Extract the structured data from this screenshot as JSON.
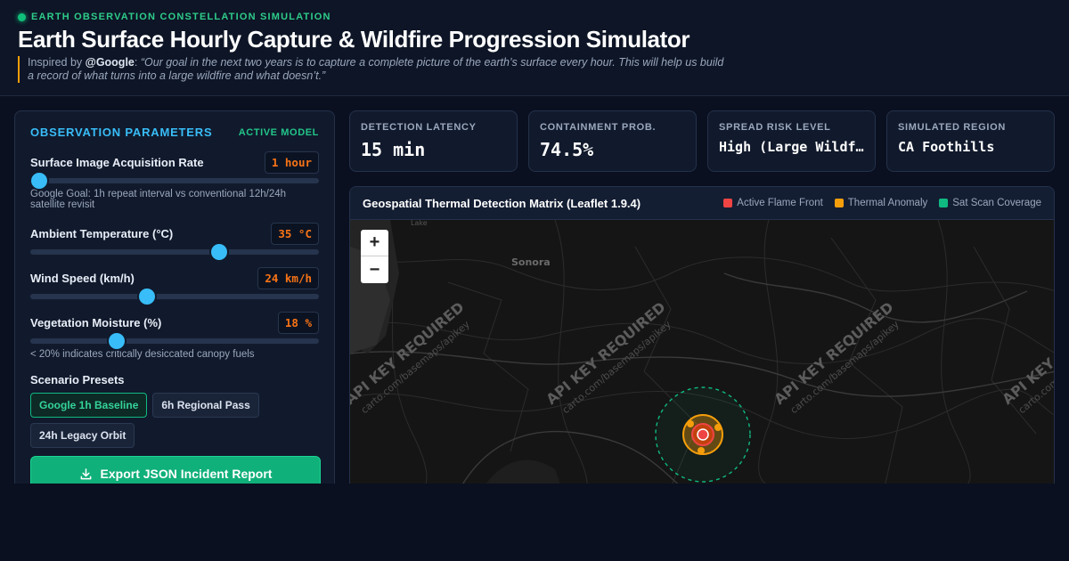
{
  "header": {
    "eyebrow": "EARTH OBSERVATION CONSTELLATION SIMULATION",
    "title": "Earth Surface Hourly Capture & Wildfire Progression Simulator",
    "quote_prefix": "Inspired by ",
    "quote_handle": "@Google",
    "quote_sep": ": ",
    "quote_text": "“Our goal in the next two years is to capture a complete picture of the earth’s surface every hour. This will help us build a record of what turns into a large wildfire and what doesn’t.”"
  },
  "panel": {
    "title": "OBSERVATION PARAMETERS",
    "badge": "ACTIVE MODEL",
    "params": [
      {
        "label": "Surface Image Acquisition Rate",
        "value": "1 hour",
        "position": 0.03,
        "note": "Google Goal: 1h repeat interval vs conventional 12h/24h satellite revisit"
      },
      {
        "label": "Ambient Temperature (°C)",
        "value": "35 °C",
        "position": 0.655,
        "note": ""
      },
      {
        "label": "Wind Speed (km/h)",
        "value": "24 km/h",
        "position": 0.405,
        "note": ""
      },
      {
        "label": "Vegetation Moisture (%)",
        "value": "18 %",
        "position": 0.3,
        "note": "< 20% indicates critically desiccated canopy fuels"
      }
    ],
    "presets_label": "Scenario Presets",
    "presets": [
      {
        "label": "Google 1h Baseline",
        "active": true
      },
      {
        "label": "6h Regional Pass",
        "active": false
      },
      {
        "label": "24h Legacy Orbit",
        "active": false
      }
    ],
    "export_label": "Export JSON Incident Report"
  },
  "kpis": [
    {
      "label": "DETECTION LATENCY",
      "value": "15 min"
    },
    {
      "label": "CONTAINMENT PROB.",
      "value": "74.5%"
    },
    {
      "label": "SPREAD RISK LEVEL",
      "value": "High (Large Wildfire)"
    },
    {
      "label": "SIMULATED REGION",
      "value": "CA Foothills"
    }
  ],
  "map": {
    "title": "Geospatial Thermal Detection Matrix (Leaflet 1.9.4)",
    "legend": [
      {
        "label": "Active Flame Front",
        "color": "#ef4444"
      },
      {
        "label": "Thermal Anomaly",
        "color": "#f59e0b"
      },
      {
        "label": "Sat Scan Coverage",
        "color": "#10b981"
      }
    ],
    "zoom_in": "+",
    "zoom_out": "−",
    "place_label": "Sonora",
    "lake_label": "Lake",
    "tile_warning": "API KEY REQUIRED",
    "tile_url": "carto.com/basemaps/apikey"
  }
}
